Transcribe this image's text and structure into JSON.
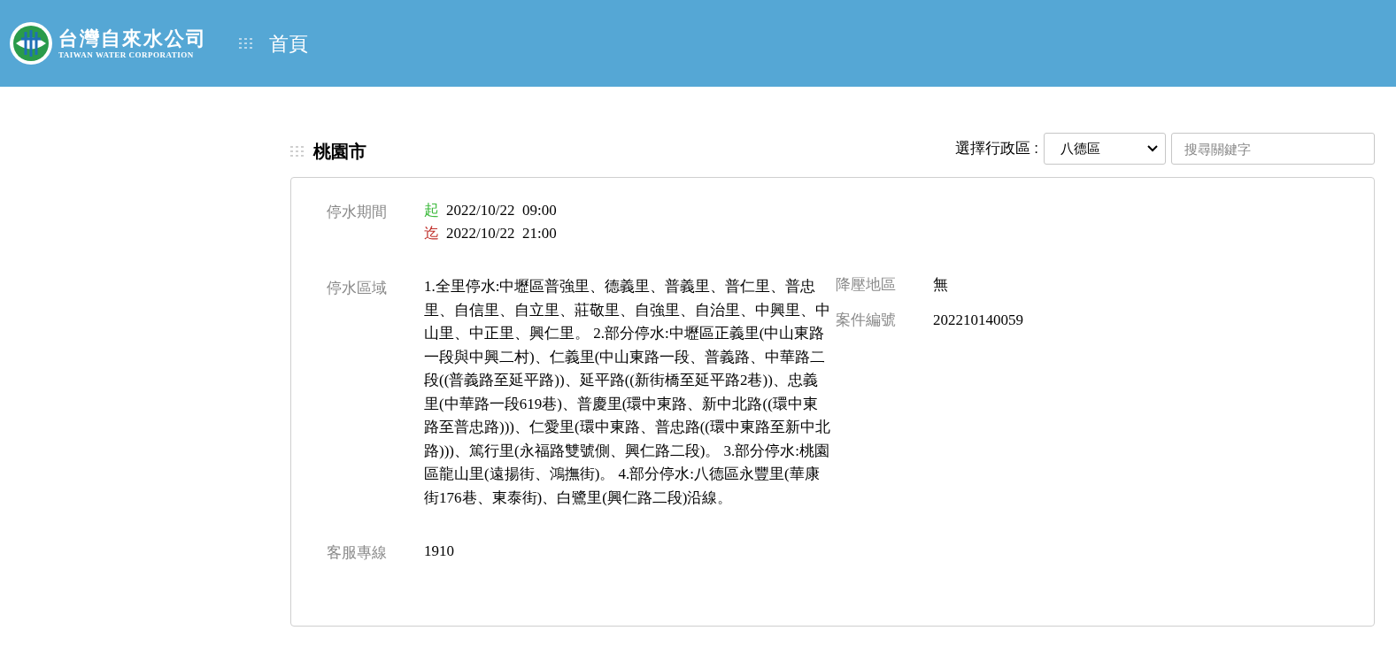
{
  "header": {
    "logo": {
      "name": "台灣自來水公司",
      "subtitle": "TAIWAN WATER CORPORATION"
    },
    "breadcrumb": "首頁"
  },
  "section": {
    "title": "桃園市",
    "filter": {
      "label": "選擇行政區 :",
      "district": "八德區",
      "search_placeholder": "搜尋關鍵字"
    }
  },
  "notice": {
    "period": {
      "label": "停水期間",
      "entries": [
        {
          "kind": "start",
          "mark": "起",
          "date": "2022/10/22  09:00"
        },
        {
          "kind": "end",
          "mark": "迄",
          "date": "2022/10/22  21:00"
        }
      ]
    },
    "area": {
      "label": "停水區域",
      "value": "1.全里停水:中壢區普強里、德義里、普義里、普仁里、普忠里、自信里、自立里、莊敬里、自強里、自治里、中興里、中山里、中正里、興仁里。 2.部分停水:中壢區正義里(中山東路一段與中興二村)、仁義里(中山東路一段、普義路、中華路二段((普義路至延平路))、延平路((新街橋至延平路2巷))、忠義里(中華路一段619巷)、普慶里(環中東路、新中北路((環中東路至普忠路)))、仁愛里(環中東路、普忠路((環中東路至新中北路)))、篤行里(永福路雙號側、興仁路二段)。 3.部分停水:桃園區龍山里(遠揚街、鴻撫街)。 4.部分停水:八德區永豐里(華康街176巷、東泰街)、白鷺里(興仁路二段)沿線。"
    },
    "pressure": {
      "label": "降壓地區",
      "value": "無"
    },
    "case": {
      "label": "案件編號",
      "value": "202210140059"
    },
    "hotline": {
      "label": "客服專線",
      "value": "1910"
    }
  }
}
